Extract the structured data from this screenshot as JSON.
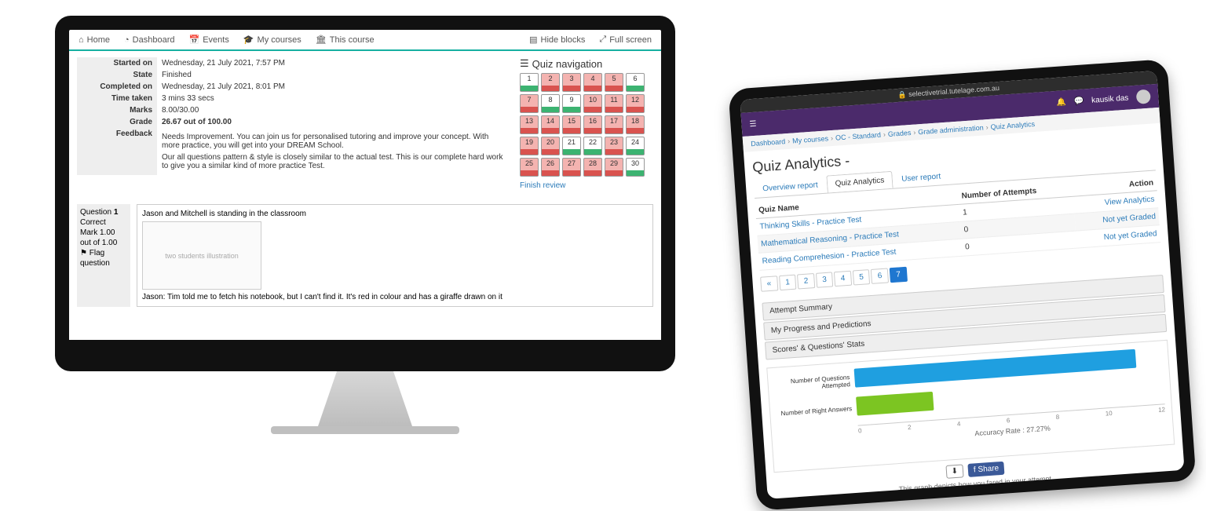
{
  "desktop": {
    "nav": {
      "home": "Home",
      "dashboard": "Dashboard",
      "events": "Events",
      "mycourses": "My courses",
      "thiscourse": "This course",
      "hideblocks": "Hide blocks",
      "fullscreen": "Full screen"
    },
    "summary": {
      "started_on_lbl": "Started on",
      "started_on": "Wednesday, 21 July 2021, 7:57 PM",
      "state_lbl": "State",
      "state": "Finished",
      "completed_on_lbl": "Completed on",
      "completed_on": "Wednesday, 21 July 2021, 8:01 PM",
      "time_taken_lbl": "Time taken",
      "time_taken": "3 mins 33 secs",
      "marks_lbl": "Marks",
      "marks": "8.00/30.00",
      "grade_lbl": "Grade",
      "grade": "26.67 out of 100.00",
      "feedback_lbl": "Feedback",
      "feedback1": "Needs Improvement. You can join us for personalised tutoring and improve your concept. With more practice, you will get into your DREAM School.",
      "feedback2": "Our all questions pattern & style is closely similar to the actual test. This is our complete hard work to give you a similar kind of more practice Test."
    },
    "navpanel": {
      "title": "Quiz navigation",
      "finish": "Finish review",
      "cells": [
        {
          "n": 1,
          "ok": true
        },
        {
          "n": 2,
          "ok": false
        },
        {
          "n": 3,
          "ok": false
        },
        {
          "n": 4,
          "ok": false
        },
        {
          "n": 5,
          "ok": false
        },
        {
          "n": 6,
          "ok": true
        },
        {
          "n": 7,
          "ok": false
        },
        {
          "n": 8,
          "ok": true
        },
        {
          "n": 9,
          "ok": true
        },
        {
          "n": 10,
          "ok": false
        },
        {
          "n": 11,
          "ok": false
        },
        {
          "n": 12,
          "ok": false
        },
        {
          "n": 13,
          "ok": false
        },
        {
          "n": 14,
          "ok": false
        },
        {
          "n": 15,
          "ok": false
        },
        {
          "n": 16,
          "ok": false
        },
        {
          "n": 17,
          "ok": false
        },
        {
          "n": 18,
          "ok": false
        },
        {
          "n": 19,
          "ok": false
        },
        {
          "n": 20,
          "ok": false
        },
        {
          "n": 21,
          "ok": true
        },
        {
          "n": 22,
          "ok": true
        },
        {
          "n": 23,
          "ok": false
        },
        {
          "n": 24,
          "ok": true
        },
        {
          "n": 25,
          "ok": false
        },
        {
          "n": 26,
          "ok": false
        },
        {
          "n": 27,
          "ok": false
        },
        {
          "n": 28,
          "ok": false
        },
        {
          "n": 29,
          "ok": false
        },
        {
          "n": 30,
          "ok": true
        }
      ]
    },
    "question": {
      "side_qnum_lbl": "Question",
      "side_qnum": "1",
      "side_correct": "Correct",
      "side_mark": "Mark 1.00 out of 1.00",
      "side_flag": "⚑ Flag question",
      "text_top": "Jason and Mitchell is standing in the classroom",
      "text_bottom": "Jason: Tim told me to fetch his notebook, but I can't find it. It's red in colour and has a giraffe drawn on it",
      "img_alt": "two students illustration"
    }
  },
  "tablet": {
    "url": "selectivetrial.tutelage.com.au",
    "username": "kausik das",
    "breadcrumb": [
      "Dashboard",
      "My courses",
      "OC - Standard",
      "Grades",
      "Grade administration",
      "Quiz Analytics"
    ],
    "title": "Quiz Analytics - ",
    "tabs": {
      "overview": "Overview report",
      "analytics": "Quiz Analytics",
      "user": "User report"
    },
    "table": {
      "headers": {
        "name": "Quiz Name",
        "attempts": "Number of Attempts",
        "action": "Action"
      },
      "rows": [
        {
          "name": "Thinking Skills - Practice Test",
          "attempts": "1",
          "action": "View Analytics"
        },
        {
          "name": "Mathematical Reasoning - Practice Test",
          "attempts": "0",
          "action": "Not yet Graded"
        },
        {
          "name": "Reading Comprehesion - Practice Test",
          "attempts": "0",
          "action": "Not yet Graded"
        }
      ]
    },
    "pagination": [
      "«",
      "1",
      "2",
      "3",
      "4",
      "5",
      "6",
      "7"
    ],
    "pagination_active": "7",
    "accordion": [
      "Attempt Summary",
      "My Progress and Predictions",
      "Scores' & Questions' Stats"
    ],
    "accuracy": "Accuracy Rate : 27.27%",
    "share": "Share",
    "caption": "This graph depicts how you fared in your attempt."
  },
  "chart_data": {
    "type": "bar",
    "orientation": "horizontal",
    "categories": [
      "Number of Questions Attempted",
      "Number of Right Answers"
    ],
    "values": [
      11,
      3
    ],
    "colors": [
      "#1f9fe0",
      "#7cc522"
    ],
    "xlabel": "",
    "ylabel": "",
    "xlim": [
      0,
      12
    ],
    "xticks": [
      0,
      2,
      4,
      6,
      8,
      10,
      12
    ],
    "title": ""
  }
}
